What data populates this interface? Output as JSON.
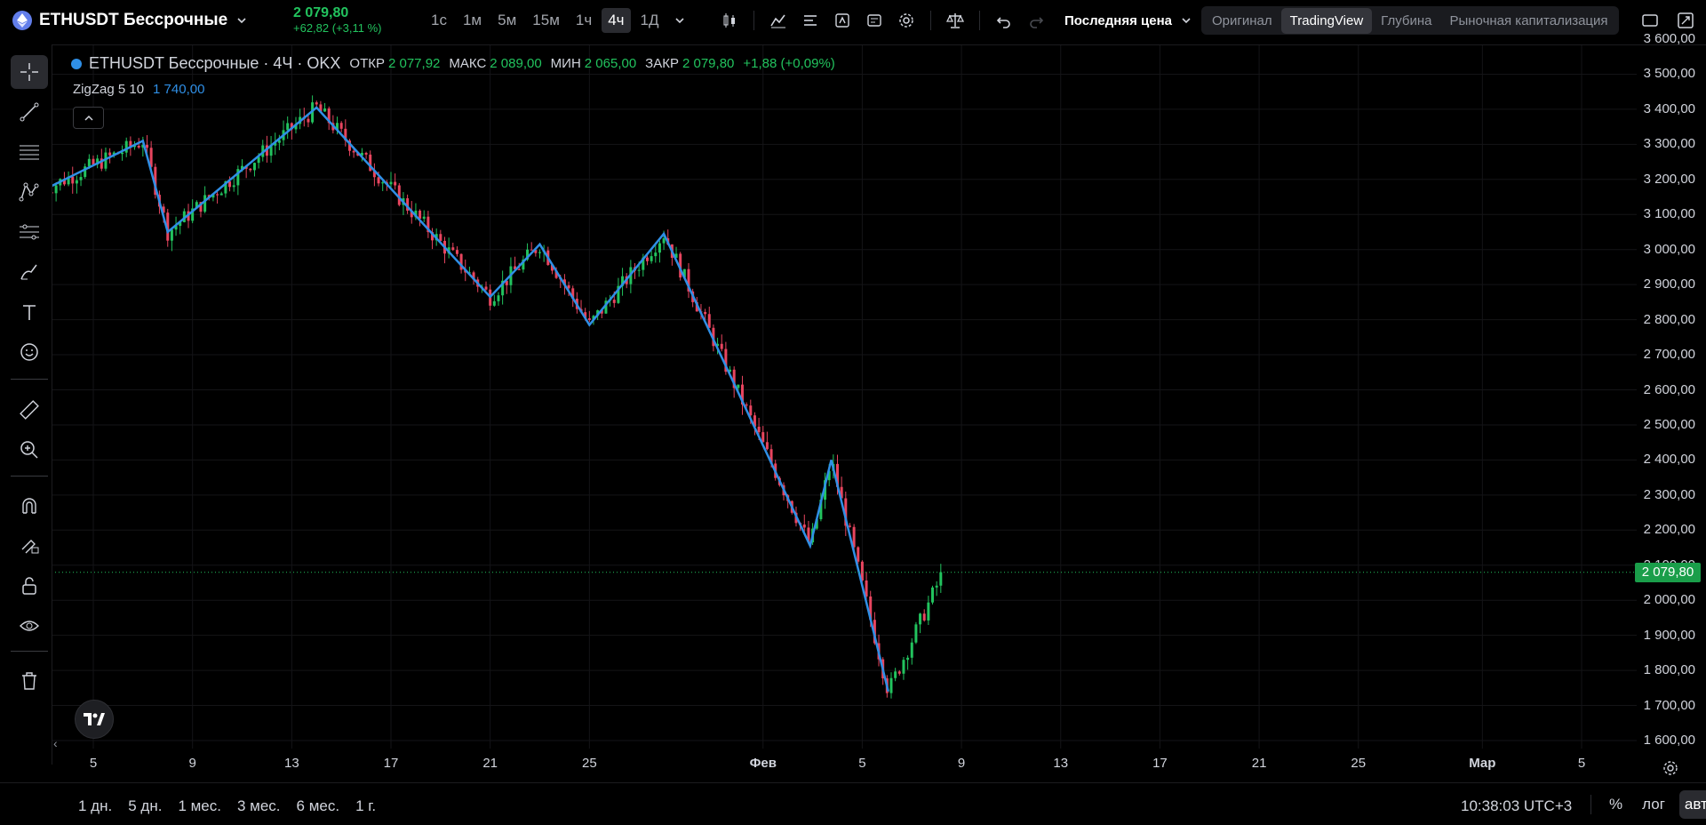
{
  "header": {
    "symbol": "ETHUSDT Бессрочные",
    "price": "2 079,80",
    "change": "+62,82 (+3,11 %)",
    "intervals": [
      "1с",
      "1м",
      "5м",
      "15м",
      "1ч",
      "4ч",
      "1Д"
    ],
    "active_interval": "4ч",
    "price_source": "Последняя цена",
    "modes": [
      "Оригинал",
      "TradingView",
      "Глубина",
      "Рыночная капитализация"
    ],
    "active_mode": "TradingView"
  },
  "legend": {
    "title": "ETHUSDT Бессрочные · 4Ч · OKX",
    "open_label": "ОТКР",
    "open": "2 077,92",
    "high_label": "МАКС",
    "high": "2 089,00",
    "low_label": "МИН",
    "low": "2 065,00",
    "close_label": "ЗАКР",
    "close": "2 079,80",
    "change": "+1,88 (+0,09%)"
  },
  "indicator": {
    "name": "ZigZag 5 10",
    "value": "1 740,00"
  },
  "price_axis": {
    "labels": [
      "3 600,00",
      "3 500,00",
      "3 400,00",
      "3 300,00",
      "3 200,00",
      "3 100,00",
      "3 000,00",
      "2 900,00",
      "2 800,00",
      "2 700,00",
      "2 600,00",
      "2 500,00",
      "2 400,00",
      "2 300,00",
      "2 200,00",
      "2 100,00",
      "2 000,00",
      "1 900,00",
      "1 800,00",
      "1 700,00",
      "1 600,00"
    ],
    "last_price_tag": "2 079,80"
  },
  "time_axis": {
    "labels": [
      "5",
      "9",
      "13",
      "17",
      "21",
      "25",
      "Фев",
      "5",
      "9",
      "13",
      "17",
      "21",
      "25",
      "Мар",
      "5"
    ]
  },
  "bottom": {
    "ranges": [
      "1 дн.",
      "5 дн.",
      "1 мес.",
      "3 мес.",
      "6 мес.",
      "1 г."
    ],
    "clock": "10:38:03 UTC+3",
    "percent": "%",
    "log": "лог",
    "auto": "авто"
  },
  "colors": {
    "up": "#22c35e",
    "down": "#e8455f",
    "zigzag": "#2f8fe6",
    "accent": "#22c35e"
  },
  "chart_data": {
    "type": "candlestick",
    "timeframe": "4ч",
    "ylim": [
      1600,
      3600
    ],
    "zigzag": [
      {
        "x": "2024-01-03",
        "y": 3170
      },
      {
        "x": "2024-01-07",
        "y": 3310
      },
      {
        "x": "2024-01-08",
        "y": 3050
      },
      {
        "x": "2024-01-14",
        "y": 3405
      },
      {
        "x": "2024-01-21",
        "y": 2865
      },
      {
        "x": "2024-01-23",
        "y": 3015
      },
      {
        "x": "2024-01-25",
        "y": 2785
      },
      {
        "x": "2024-01-28",
        "y": 3045
      },
      {
        "x": "2024-02-03",
        "y": 2155
      },
      {
        "x": "2024-02-03",
        "y": 2400
      },
      {
        "x": "2024-02-06",
        "y": 1740
      }
    ],
    "last_close": 2079.8
  }
}
